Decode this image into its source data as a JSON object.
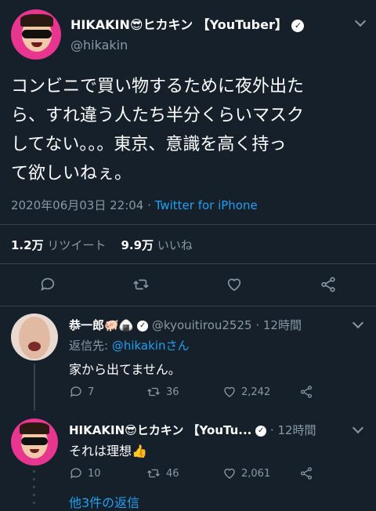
{
  "main_tweet": {
    "display_name": "HIKAKIN😎ヒカキン 【YouTuber】",
    "handle": "@hikakin",
    "text_lines": [
      "コンビニで買い物するために夜外出た",
      "ら、すれ違う人たち半分くらいマスク",
      "してない。。。東京、意識を高く持っ",
      "て欲しいねぇ。"
    ],
    "timestamp": "2020年06月03日 22:04 · ",
    "source": "Twitter for iPhone",
    "retweet_count": "1.2万",
    "retweet_label": "リツイート",
    "like_count": "9.9万",
    "like_label": "いいね"
  },
  "reply1": {
    "display_name": "恭一郎🐖🍙",
    "handle": "@kyouitirou2525 · 12時間",
    "reply_to_prefix": "返信先: ",
    "reply_to_handle": "@hikakinさん",
    "text": "家から出てません。",
    "reply_count": "7",
    "retweet_count": "36",
    "like_count": "2,242"
  },
  "reply2": {
    "display_name": "HIKAKIN😎ヒカキン 【YouTu...",
    "time": "· 12時間",
    "text": "それは理想👍",
    "reply_count": "10",
    "retweet_count": "46",
    "like_count": "2,061"
  },
  "more_replies": "他3件の返信",
  "colors": {
    "background": "#15202b",
    "accent": "#1da1f2",
    "muted": "#8899a6",
    "divider": "#38444d"
  }
}
